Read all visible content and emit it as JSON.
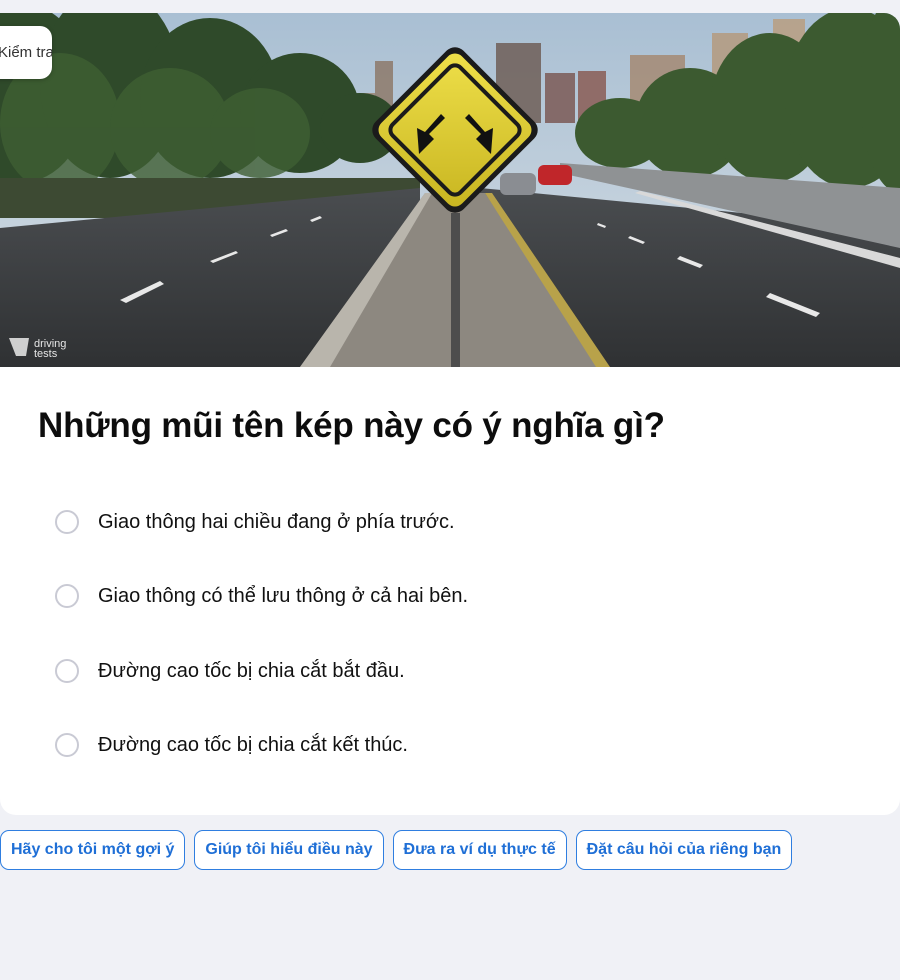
{
  "header": {
    "badge_text": "Kiểm tra"
  },
  "hero": {
    "logo_line1": "driving",
    "logo_line2": "tests"
  },
  "question": {
    "text": "Những mũi tên kép này có ý nghĩa gì?"
  },
  "options": [
    {
      "label": "Giao thông hai chiều đang ở phía trước."
    },
    {
      "label": "Giao thông có thể lưu thông ở cả hai bên."
    },
    {
      "label": "Đường cao tốc bị chia cắt bắt đầu."
    },
    {
      "label": "Đường cao tốc bị chia cắt kết thúc."
    }
  ],
  "suggestions": [
    {
      "label": "Hãy cho tôi một gợi ý"
    },
    {
      "label": "Giúp tôi hiểu điều này"
    },
    {
      "label": "Đưa ra ví dụ thực tế"
    },
    {
      "label": "Đặt câu hỏi của riêng bạn"
    }
  ],
  "colors": {
    "accent": "#1f6fd6",
    "sign": "#e3d230",
    "background": "#f0f1f6"
  }
}
